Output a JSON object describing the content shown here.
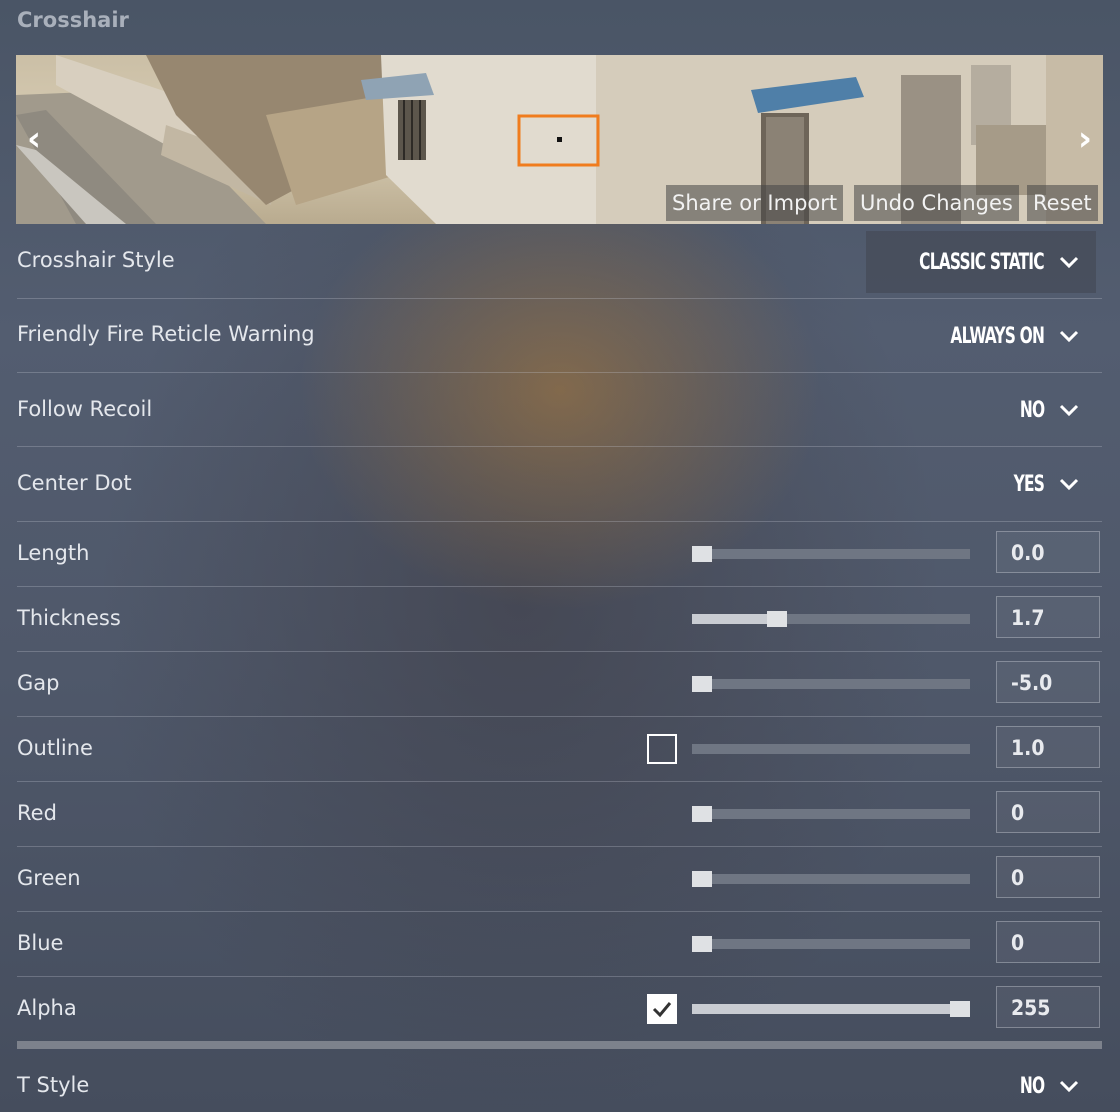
{
  "section_title": "Crosshair",
  "preview": {
    "prev_icon": "chevron-left-icon",
    "next_icon": "chevron-right-icon",
    "share_label": "Share or Import",
    "undo_label": "Undo Changes",
    "reset_label": "Reset",
    "crosshair_marker_color": "#f07c1e"
  },
  "dropdowns": [
    {
      "label": "Crosshair Style",
      "value": "CLASSIC STATIC"
    },
    {
      "label": "Friendly Fire Reticle Warning",
      "value": "ALWAYS ON"
    },
    {
      "label": "Follow Recoil",
      "value": "NO"
    },
    {
      "label": "Center Dot",
      "value": "YES"
    }
  ],
  "sliders": [
    {
      "label": "Length",
      "value": "0.0",
      "level": 0.0
    },
    {
      "label": "Thickness",
      "value": "1.7",
      "level": 0.29
    },
    {
      "label": "Gap",
      "value": "-5.0",
      "level": 0.0
    },
    {
      "label": "Outline",
      "value": "1.0",
      "level": 0.0,
      "checkbox": false
    },
    {
      "label": "Red",
      "value": "0",
      "level": 0.0
    },
    {
      "label": "Green",
      "value": "0",
      "level": 0.0
    },
    {
      "label": "Blue",
      "value": "0",
      "level": 0.0
    },
    {
      "label": "Alpha",
      "value": "255",
      "level": 1.0,
      "checkbox": true
    }
  ],
  "t_style": {
    "label": "T Style",
    "value": "NO"
  }
}
